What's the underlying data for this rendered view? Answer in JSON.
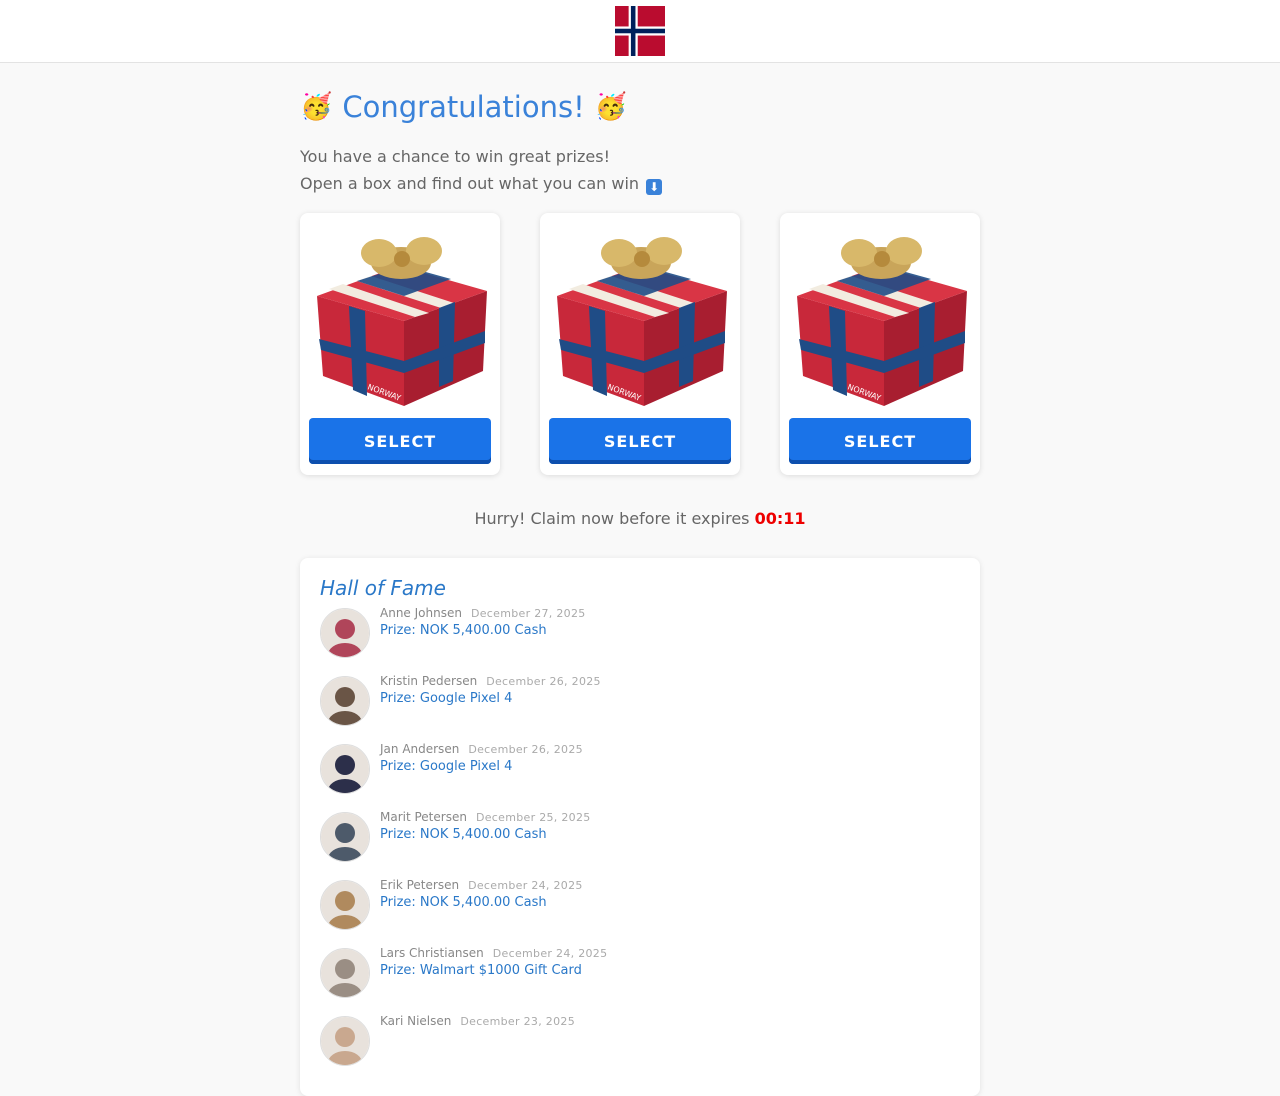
{
  "header": {
    "flag_icon": "norway-flag"
  },
  "hero": {
    "title": "Congratulations!",
    "party_icon": "🥳",
    "line1": "You have a chance to win great prizes!",
    "line2": "Open a box and find out what you can win",
    "arrow_icon": "⬇"
  },
  "boxes": [
    {
      "button": "SELECT",
      "gift_label": "NORWAY"
    },
    {
      "button": "SELECT",
      "gift_label": "NORWAY"
    },
    {
      "button": "SELECT",
      "gift_label": "NORWAY"
    }
  ],
  "timer": {
    "text": "Hurry! Claim now before it expires",
    "value": "00:11"
  },
  "hall_of_fame": {
    "title": "Hall of Fame",
    "winners": [
      {
        "name": "Anne Johnsen",
        "date": "December 27, 2025",
        "prize": "Prize: NOK 5,400.00 Cash",
        "avatar_color": "#b0455a"
      },
      {
        "name": "Kristin Pedersen",
        "date": "December 26, 2025",
        "prize": "Prize: Google Pixel 4",
        "avatar_color": "#6a5546"
      },
      {
        "name": "Jan Andersen",
        "date": "December 26, 2025",
        "prize": "Prize: Google Pixel 4",
        "avatar_color": "#2c2f4a"
      },
      {
        "name": "Marit Petersen",
        "date": "December 25, 2025",
        "prize": "Prize: NOK 5,400.00 Cash",
        "avatar_color": "#4d5a6a"
      },
      {
        "name": "Erik Petersen",
        "date": "December 24, 2025",
        "prize": "Prize: NOK 5,400.00 Cash",
        "avatar_color": "#b08a5e"
      },
      {
        "name": "Lars Christiansen",
        "date": "December 24, 2025",
        "prize": "Prize: Walmart $1000 Gift Card",
        "avatar_color": "#9a8e84"
      },
      {
        "name": "Kari Nielsen",
        "date": "December 23, 2025",
        "prize": "",
        "avatar_color": "#c9a88f"
      }
    ]
  },
  "colors": {
    "accent": "#1a73e8",
    "title": "#3a82d9",
    "timer": "#ee0000",
    "flag_red": "#ba0c2f",
    "flag_blue": "#00205b"
  }
}
